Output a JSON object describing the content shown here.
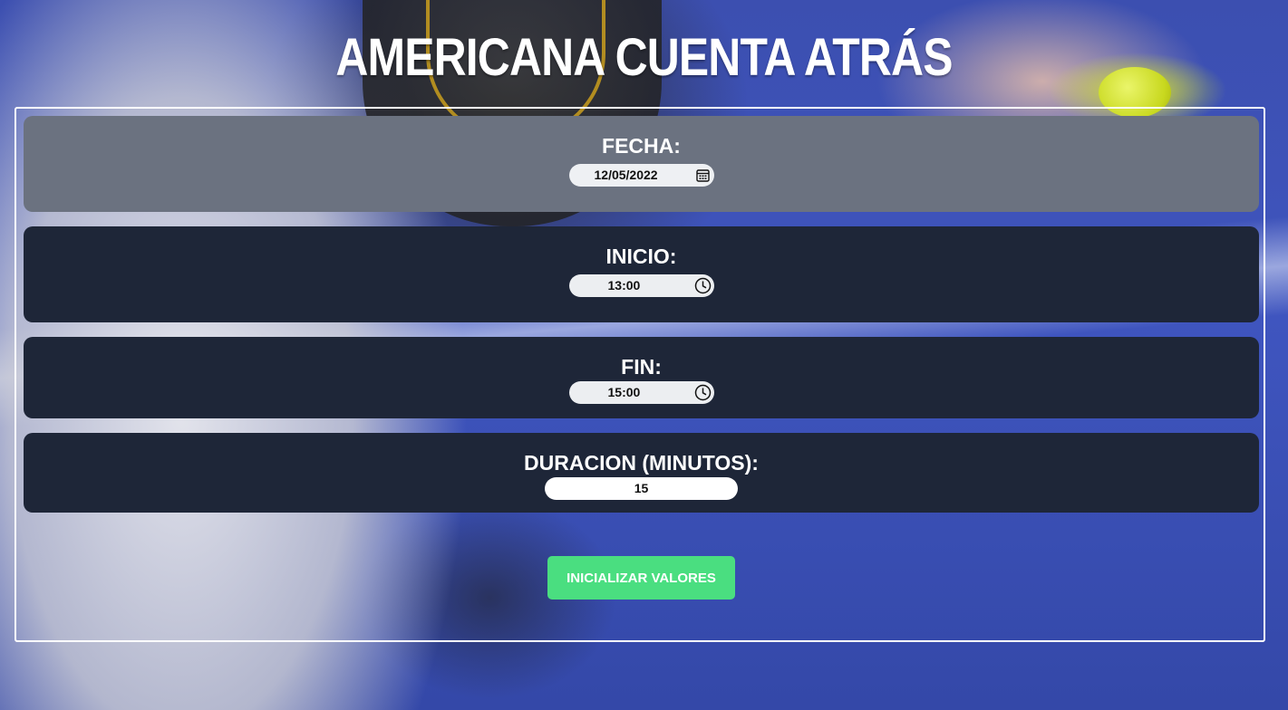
{
  "page": {
    "title": "AMERICANA CUENTA ATRÁS"
  },
  "form": {
    "fecha": {
      "label": "FECHA:",
      "value": "12/05/2022",
      "icon": "calendar-icon"
    },
    "inicio": {
      "label": "INICIO:",
      "value": "13:00",
      "icon": "clock-icon"
    },
    "fin": {
      "label": "FIN:",
      "value": "15:00",
      "icon": "clock-icon"
    },
    "duracion": {
      "label": "DURACION (MINUTOS):",
      "value": "15"
    },
    "submit_label": "INICIALIZAR VALORES"
  },
  "colors": {
    "title": "#ffffff",
    "card_active": "#6b7280",
    "card": "#1e2638",
    "button": "#4ade80",
    "background": "#3f55bf"
  }
}
